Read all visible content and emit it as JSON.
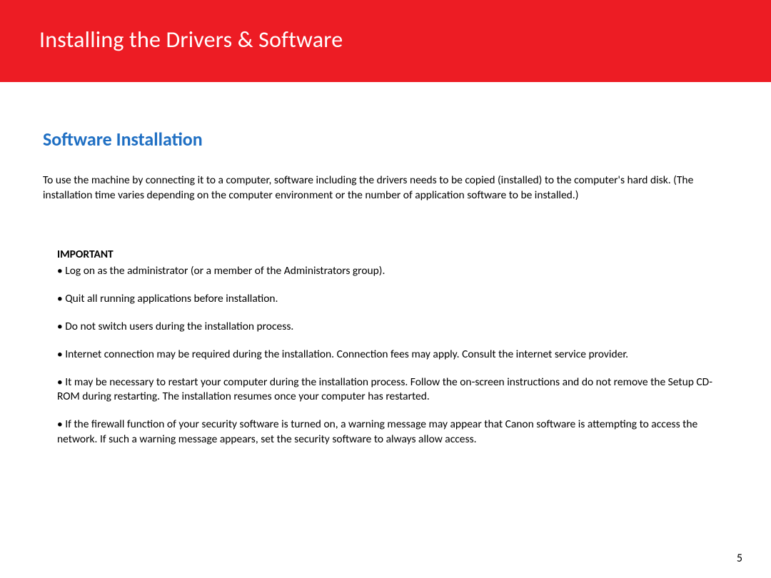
{
  "header": {
    "title": "Installing  the Drivers & Software"
  },
  "section": {
    "heading": "Software Installation",
    "intro": "To use the machine by connecting it to a computer, software including the drivers needs to be copied (installed) to the computer's hard disk. (The installation time varies depending on the computer environment or the number of application software to be installed.)"
  },
  "important": {
    "label": "IMPORTANT",
    "bullets": [
      "• Log on as the administrator (or a member of the Administrators group).",
      "• Quit all running applications before installation.",
      "• Do not switch users during the installation process.",
      "• Internet connection may be required during the installation. Connection fees may apply. Consult the internet service provider.",
      "• It may be necessary to restart your computer during the installation process. Follow the on-screen instructions and do not remove the Setup CD-ROM during restarting. The installation resumes once your computer has restarted.",
      "• If the firewall function of your security software is turned on, a warning message may appear that Canon software is attempting to access the network. If such a warning message appears, set the security software to always allow access."
    ]
  },
  "page_number": "5"
}
